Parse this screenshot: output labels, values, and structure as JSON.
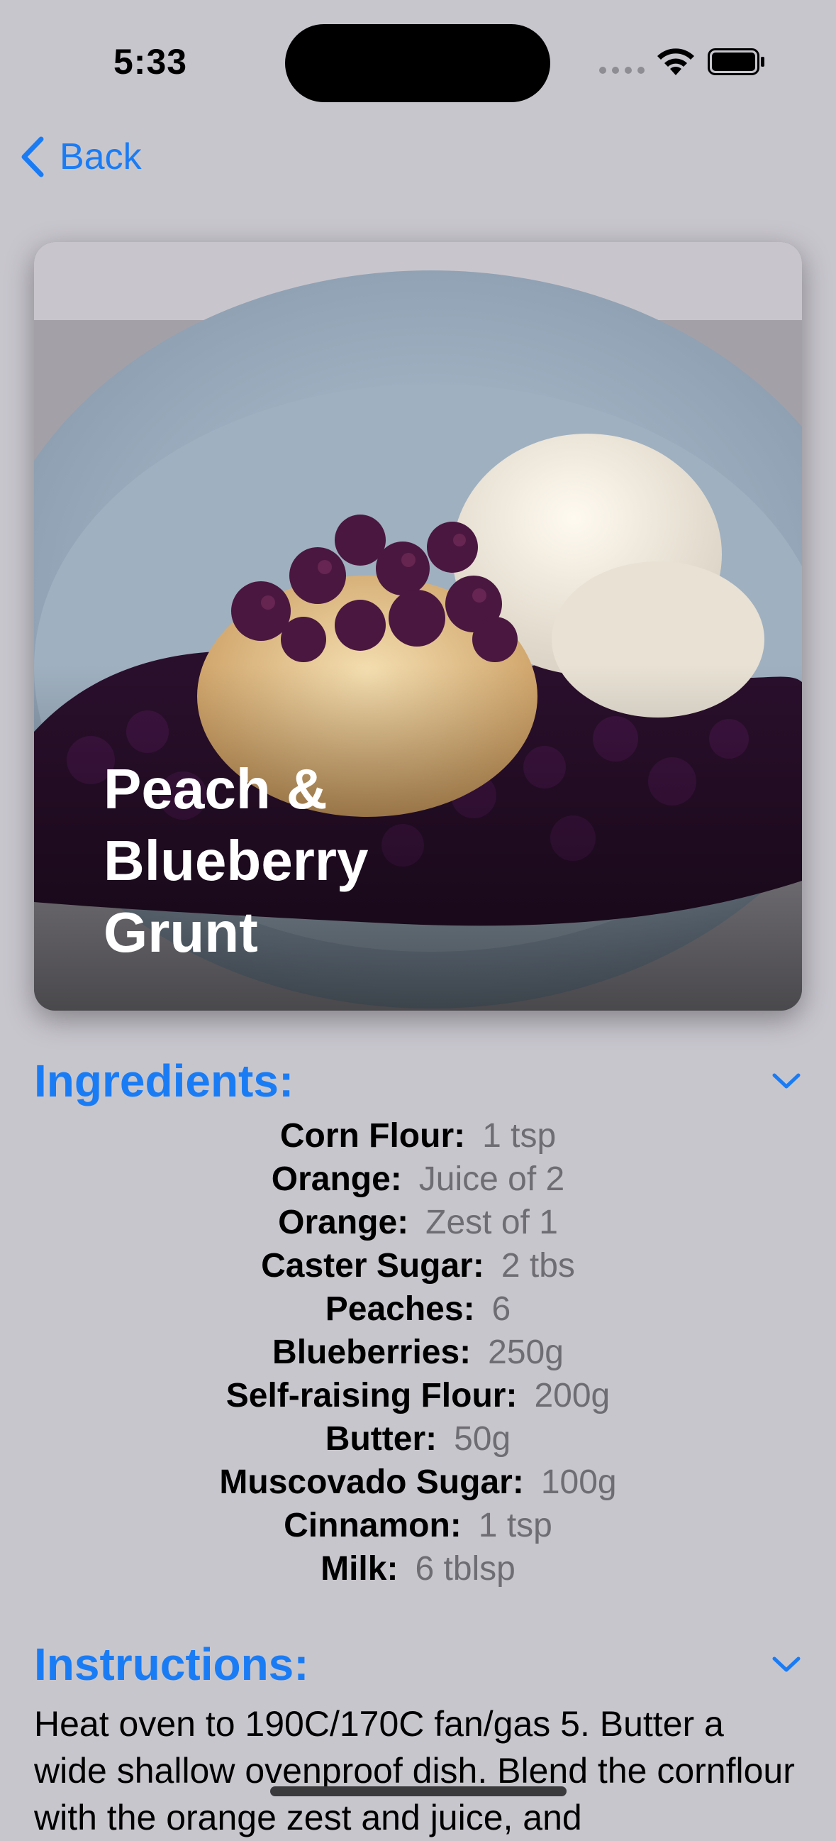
{
  "status": {
    "time": "5:33"
  },
  "nav": {
    "back_label": "Back"
  },
  "recipe": {
    "title": "Peach & Blueberry Grunt"
  },
  "ingredients": {
    "header": "Ingredients:",
    "items": [
      {
        "name": "Corn Flour:",
        "qty": "1 tsp"
      },
      {
        "name": "Orange:",
        "qty": "Juice of 2"
      },
      {
        "name": "Orange:",
        "qty": "Zest of 1"
      },
      {
        "name": "Caster Sugar:",
        "qty": "2 tbs"
      },
      {
        "name": "Peaches:",
        "qty": "6"
      },
      {
        "name": "Blueberries:",
        "qty": "250g"
      },
      {
        "name": "Self-raising Flour:",
        "qty": "200g"
      },
      {
        "name": "Butter:",
        "qty": "50g"
      },
      {
        "name": "Muscovado Sugar:",
        "qty": "100g"
      },
      {
        "name": "Cinnamon:",
        "qty": "1 tsp"
      },
      {
        "name": "Milk:",
        "qty": "6 tblsp"
      }
    ]
  },
  "instructions": {
    "header": "Instructions:",
    "text": "Heat oven to 190C/170C fan/gas 5. Butter a wide shallow ovenproof dish. Blend the cornflour with the orange zest and juice, and"
  },
  "icons": {
    "back": "chevron-left-icon",
    "collapse": "chevron-down-icon",
    "wifi": "wifi-icon",
    "battery": "battery-icon",
    "signal": "cellular-signal-icon"
  },
  "colors": {
    "accent": "#1a7cf5",
    "background": "#c8c6cd",
    "secondary_text": "#6e6d73"
  }
}
